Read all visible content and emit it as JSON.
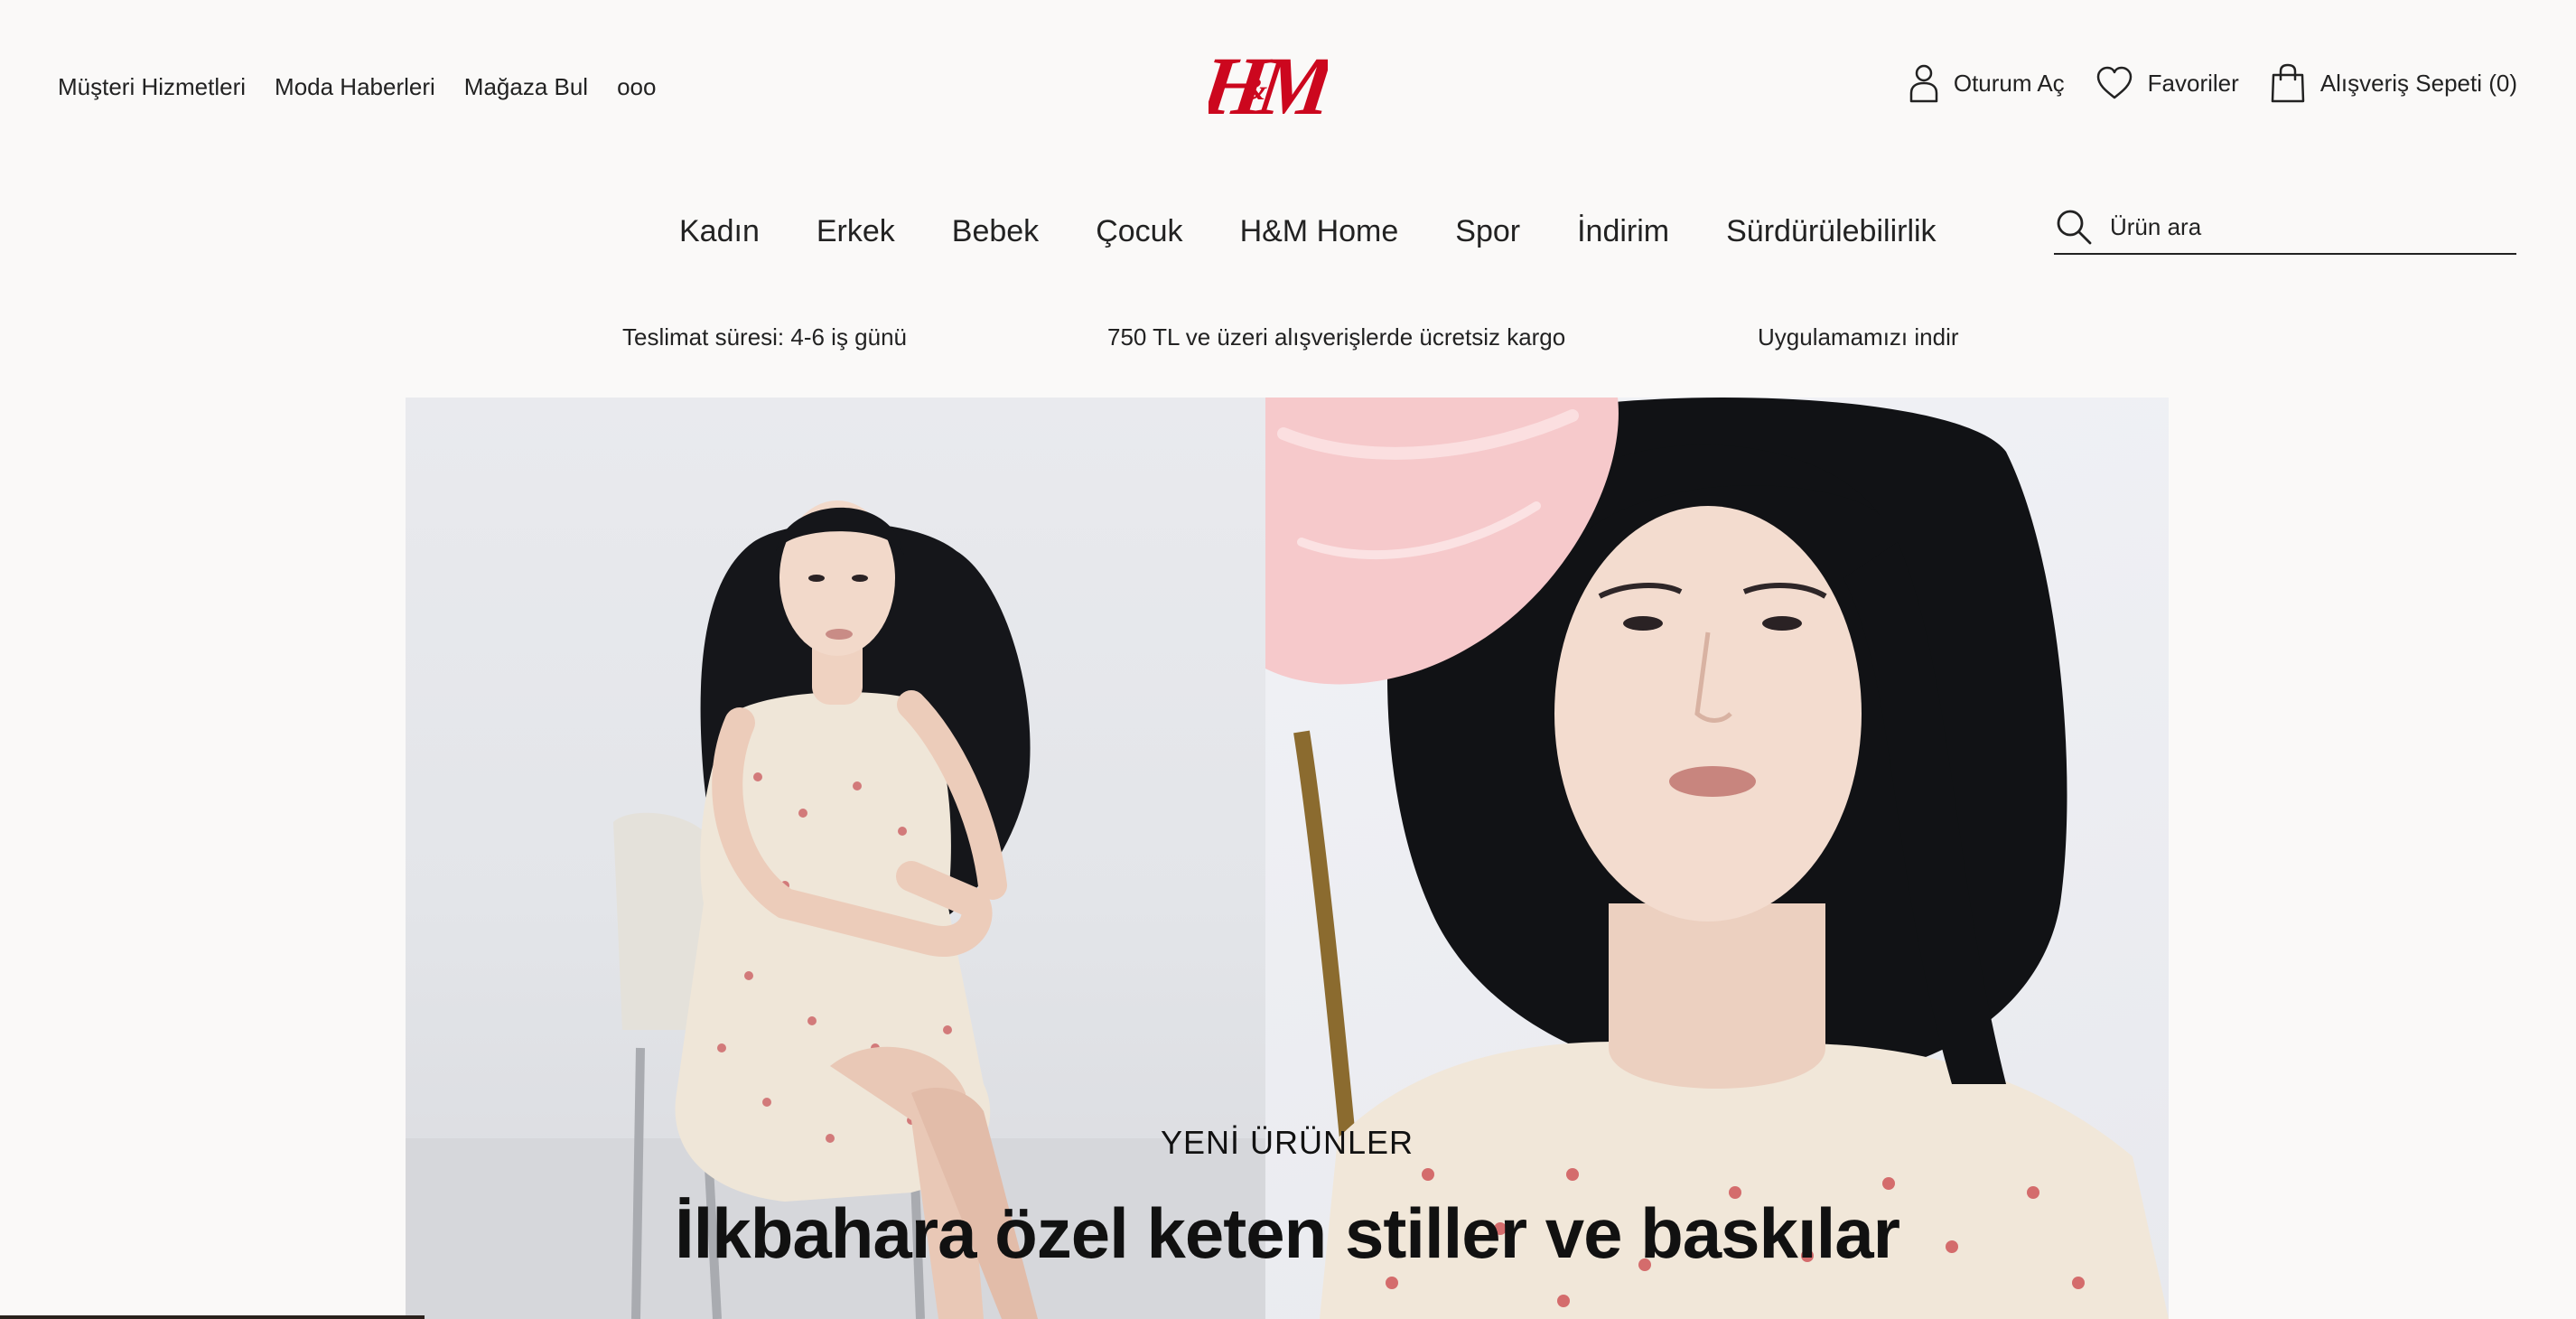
{
  "utility_links": [
    "Müşteri Hizmetleri",
    "Moda Haberleri",
    "Mağaza Bul",
    "ooo"
  ],
  "brand": {
    "logo_text": "H&M",
    "color": "#cc071e"
  },
  "account": {
    "login": "Oturum Aç",
    "favorites": "Favoriler",
    "cart": "Alışveriş Sepeti (0)"
  },
  "main_nav": [
    "Kadın",
    "Erkek",
    "Bebek",
    "Çocuk",
    "H&M Home",
    "Spor",
    "İndirim",
    "Sürdürülebilirlik"
  ],
  "search": {
    "placeholder": "Ürün ara"
  },
  "promo": {
    "delivery": "Teslimat süresi: 4-6 iş günü",
    "shipping": "750 TL ve üzeri alışverişlerde ücretsiz kargo",
    "app": "Uygulamamızı indir"
  },
  "hero": {
    "kicker": "YENİ ÜRÜNLER",
    "title": "İlkbahara özel keten stiller ve baskılar"
  }
}
